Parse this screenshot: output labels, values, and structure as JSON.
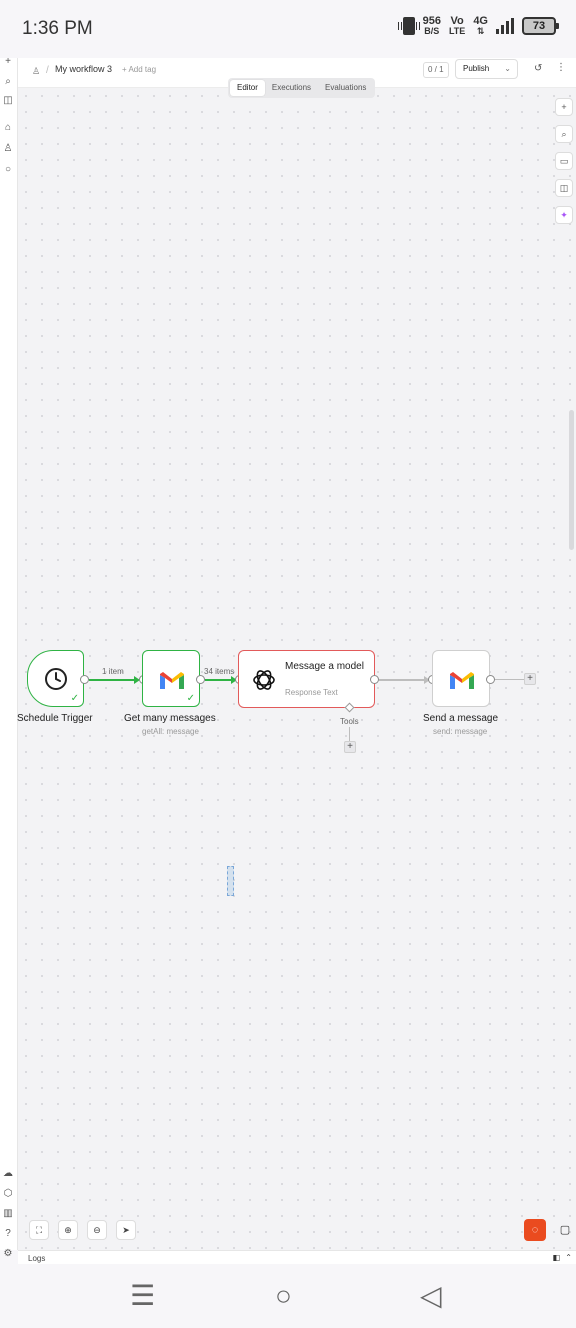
{
  "status_bar": {
    "time": "1:36 PM",
    "net_speed": "956",
    "net_unit": "B/S",
    "volte_top": "Vo",
    "volte_bottom": "LTE",
    "network": "4G",
    "battery": "73"
  },
  "header": {
    "workflow_name": "My workflow 3",
    "add_tag": "+ Add tag",
    "counter": "0 / 1",
    "publish_label": "Publish",
    "user_icon": "user-icon",
    "history_icon": "history-icon",
    "more_icon": "more-vertical-icon"
  },
  "tabs": [
    "Editor",
    "Executions",
    "Evaluations"
  ],
  "nodes": {
    "schedule": {
      "label": "Schedule Trigger"
    },
    "gmail_get": {
      "label": "Get many messages",
      "sub": "getAll: message"
    },
    "openai": {
      "title": "Message a model",
      "sub": "Response Text",
      "tools_label": "Tools"
    },
    "gmail_send": {
      "label": "Send a message",
      "sub": "send: message"
    }
  },
  "edges": {
    "e1_label": "1 item",
    "e2_label": "34 items"
  },
  "logs": {
    "label": "Logs"
  },
  "colors": {
    "success": "#2fb344",
    "error": "#e25a5a",
    "accent": "#ea4b1f"
  }
}
